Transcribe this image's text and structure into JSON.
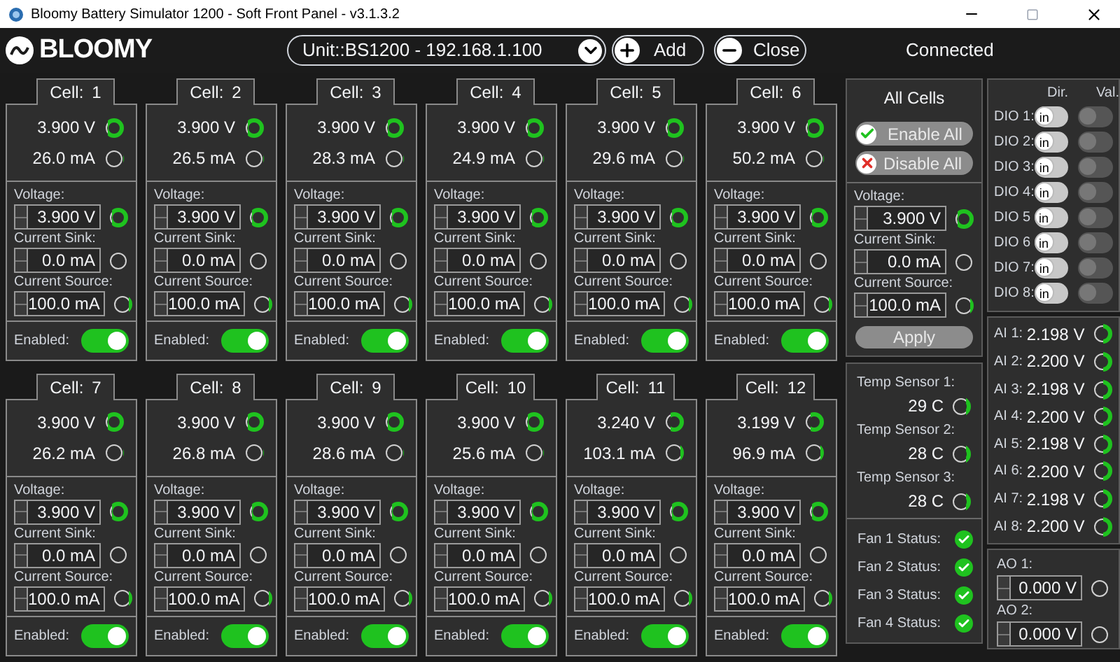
{
  "window": {
    "title": "Bloomy Battery Simulator 1200 - Soft Front Panel - v3.1.3.2"
  },
  "header": {
    "logo": "BLOOMY",
    "unit_select": "Unit::BS1200 - 192.168.1.100",
    "add_button": "Add",
    "close_button": "Close",
    "status": "Connected"
  },
  "cells": [
    {
      "tab": "Cell:",
      "number": "1",
      "readings": [
        {
          "value": "3.900 V",
          "level": 0.8
        },
        {
          "value": "26.0 mA",
          "level": 0.05
        }
      ],
      "settings": [
        {
          "label": "Voltage:",
          "value": "3.900 V",
          "level": 0.8
        },
        {
          "label": "Current Sink:",
          "value": "0.0 mA",
          "level": 0
        },
        {
          "label": "Current Source:",
          "value": "100.0 mA",
          "level": 0.2
        }
      ],
      "enabled_label": "Enabled:",
      "enabled": true
    },
    {
      "tab": "Cell:",
      "number": "2",
      "readings": [
        {
          "value": "3.900 V",
          "level": 0.8
        },
        {
          "value": "26.5 mA",
          "level": 0.05
        }
      ],
      "settings": [
        {
          "label": "Voltage:",
          "value": "3.900 V",
          "level": 0.8
        },
        {
          "label": "Current Sink:",
          "value": "0.0 mA",
          "level": 0
        },
        {
          "label": "Current Source:",
          "value": "100.0 mA",
          "level": 0.2
        }
      ],
      "enabled_label": "Enabled:",
      "enabled": true
    },
    {
      "tab": "Cell:",
      "number": "3",
      "readings": [
        {
          "value": "3.900 V",
          "level": 0.8
        },
        {
          "value": "28.3 mA",
          "level": 0.05
        }
      ],
      "settings": [
        {
          "label": "Voltage:",
          "value": "3.900 V",
          "level": 0.8
        },
        {
          "label": "Current Sink:",
          "value": "0.0 mA",
          "level": 0
        },
        {
          "label": "Current Source:",
          "value": "100.0 mA",
          "level": 0.2
        }
      ],
      "enabled_label": "Enabled:",
      "enabled": true
    },
    {
      "tab": "Cell:",
      "number": "4",
      "readings": [
        {
          "value": "3.900 V",
          "level": 0.8
        },
        {
          "value": "24.9 mA",
          "level": 0.05
        }
      ],
      "settings": [
        {
          "label": "Voltage:",
          "value": "3.900 V",
          "level": 0.8
        },
        {
          "label": "Current Sink:",
          "value": "0.0 mA",
          "level": 0
        },
        {
          "label": "Current Source:",
          "value": "100.0 mA",
          "level": 0.2
        }
      ],
      "enabled_label": "Enabled:",
      "enabled": true
    },
    {
      "tab": "Cell:",
      "number": "5",
      "readings": [
        {
          "value": "3.900 V",
          "level": 0.8
        },
        {
          "value": "29.6 mA",
          "level": 0.05
        }
      ],
      "settings": [
        {
          "label": "Voltage:",
          "value": "3.900 V",
          "level": 0.8
        },
        {
          "label": "Current Sink:",
          "value": "0.0 mA",
          "level": 0
        },
        {
          "label": "Current Source:",
          "value": "100.0 mA",
          "level": 0.2
        }
      ],
      "enabled_label": "Enabled:",
      "enabled": true
    },
    {
      "tab": "Cell:",
      "number": "6",
      "readings": [
        {
          "value": "3.900 V",
          "level": 0.8
        },
        {
          "value": "50.2 mA",
          "level": 0.1
        }
      ],
      "settings": [
        {
          "label": "Voltage:",
          "value": "3.900 V",
          "level": 0.8
        },
        {
          "label": "Current Sink:",
          "value": "0.0 mA",
          "level": 0
        },
        {
          "label": "Current Source:",
          "value": "100.0 mA",
          "level": 0.2
        }
      ],
      "enabled_label": "Enabled:",
      "enabled": true
    },
    {
      "tab": "Cell:",
      "number": "7",
      "readings": [
        {
          "value": "3.900 V",
          "level": 0.8
        },
        {
          "value": "26.2 mA",
          "level": 0.05
        }
      ],
      "settings": [
        {
          "label": "Voltage:",
          "value": "3.900 V",
          "level": 0.8
        },
        {
          "label": "Current Sink:",
          "value": "0.0 mA",
          "level": 0
        },
        {
          "label": "Current Source:",
          "value": "100.0 mA",
          "level": 0.2
        }
      ],
      "enabled_label": "Enabled:",
      "enabled": true
    },
    {
      "tab": "Cell:",
      "number": "8",
      "readings": [
        {
          "value": "3.900 V",
          "level": 0.8
        },
        {
          "value": "26.8 mA",
          "level": 0.05
        }
      ],
      "settings": [
        {
          "label": "Voltage:",
          "value": "3.900 V",
          "level": 0.8
        },
        {
          "label": "Current Sink:",
          "value": "0.0 mA",
          "level": 0
        },
        {
          "label": "Current Source:",
          "value": "100.0 mA",
          "level": 0.2
        }
      ],
      "enabled_label": "Enabled:",
      "enabled": true
    },
    {
      "tab": "Cell:",
      "number": "9",
      "readings": [
        {
          "value": "3.900 V",
          "level": 0.8
        },
        {
          "value": "28.6 mA",
          "level": 0.05
        }
      ],
      "settings": [
        {
          "label": "Voltage:",
          "value": "3.900 V",
          "level": 0.8
        },
        {
          "label": "Current Sink:",
          "value": "0.0 mA",
          "level": 0
        },
        {
          "label": "Current Source:",
          "value": "100.0 mA",
          "level": 0.2
        }
      ],
      "enabled_label": "Enabled:",
      "enabled": true
    },
    {
      "tab": "Cell:",
      "number": "10",
      "readings": [
        {
          "value": "3.900 V",
          "level": 0.8
        },
        {
          "value": "25.6 mA",
          "level": 0.05
        }
      ],
      "settings": [
        {
          "label": "Voltage:",
          "value": "3.900 V",
          "level": 0.8
        },
        {
          "label": "Current Sink:",
          "value": "0.0 mA",
          "level": 0
        },
        {
          "label": "Current Source:",
          "value": "100.0 mA",
          "level": 0.2
        }
      ],
      "enabled_label": "Enabled:",
      "enabled": true
    },
    {
      "tab": "Cell:",
      "number": "11",
      "readings": [
        {
          "value": "3.240 V",
          "level": 0.65
        },
        {
          "value": "103.1 mA",
          "level": 0.2
        }
      ],
      "settings": [
        {
          "label": "Voltage:",
          "value": "3.900 V",
          "level": 0.8
        },
        {
          "label": "Current Sink:",
          "value": "0.0 mA",
          "level": 0
        },
        {
          "label": "Current Source:",
          "value": "100.0 mA",
          "level": 0.2
        }
      ],
      "enabled_label": "Enabled:",
      "enabled": true
    },
    {
      "tab": "Cell:",
      "number": "12",
      "readings": [
        {
          "value": "3.199 V",
          "level": 0.64
        },
        {
          "value": "96.9 mA",
          "level": 0.19
        }
      ],
      "settings": [
        {
          "label": "Voltage:",
          "value": "3.900 V",
          "level": 0.8
        },
        {
          "label": "Current Sink:",
          "value": "0.0 mA",
          "level": 0
        },
        {
          "label": "Current Source:",
          "value": "100.0 mA",
          "level": 0.2
        }
      ],
      "enabled_label": "Enabled:",
      "enabled": true
    }
  ],
  "all_cells": {
    "title": "All Cells",
    "enable_all": "Enable All",
    "disable_all": "Disable All",
    "settings": [
      {
        "label": "Voltage:",
        "value": "3.900 V",
        "level": 0.8
      },
      {
        "label": "Current Sink:",
        "value": "0.0 mA",
        "level": 0
      },
      {
        "label": "Current Source:",
        "value": "100.0 mA",
        "level": 0.2
      }
    ],
    "apply_button": "Apply"
  },
  "temp_sensors": [
    {
      "label": "Temp Sensor 1:",
      "value": "29 C",
      "level": 0.3
    },
    {
      "label": "Temp Sensor 2:",
      "value": "28 C",
      "level": 0.3
    },
    {
      "label": "Temp Sensor 3:",
      "value": "28 C",
      "level": 0.3
    }
  ],
  "fans": [
    {
      "label": "Fan 1 Status:",
      "ok": true
    },
    {
      "label": "Fan 2 Status:",
      "ok": true
    },
    {
      "label": "Fan 3 Status:",
      "ok": true
    },
    {
      "label": "Fan 4 Status:",
      "ok": true
    }
  ],
  "dio": {
    "dir_header": "Dir.",
    "val_header": "Val.",
    "items": [
      {
        "label": "DIO 1:",
        "dir": "in",
        "on": false
      },
      {
        "label": "DIO 2:",
        "dir": "in",
        "on": false
      },
      {
        "label": "DIO 3:",
        "dir": "in",
        "on": false
      },
      {
        "label": "DIO 4:",
        "dir": "in",
        "on": false
      },
      {
        "label": "DIO 5",
        "dir": "in",
        "on": false
      },
      {
        "label": "DIO 6",
        "dir": "in",
        "on": false
      },
      {
        "label": "DIO 7:",
        "dir": "in",
        "on": false
      },
      {
        "label": "DIO 8:",
        "dir": "in",
        "on": false
      }
    ]
  },
  "analog_inputs": [
    {
      "label": "AI 1:",
      "value": "2.198 V",
      "level": 0.45
    },
    {
      "label": "AI 2:",
      "value": "2.200 V",
      "level": 0.45
    },
    {
      "label": "AI 3:",
      "value": "2.198 V",
      "level": 0.45
    },
    {
      "label": "AI 4:",
      "value": "2.200 V",
      "level": 0.45
    },
    {
      "label": "AI 5:",
      "value": "2.198 V",
      "level": 0.45
    },
    {
      "label": "AI 6:",
      "value": "2.200 V",
      "level": 0.45
    },
    {
      "label": "AI 7:",
      "value": "2.198 V",
      "level": 0.45
    },
    {
      "label": "AI 8:",
      "value": "2.200 V",
      "level": 0.45
    }
  ],
  "analog_outputs": [
    {
      "label": "AO 1:",
      "value": "0.000 V",
      "level": 0
    },
    {
      "label": "AO 2:",
      "value": "0.000 V",
      "level": 0
    }
  ]
}
